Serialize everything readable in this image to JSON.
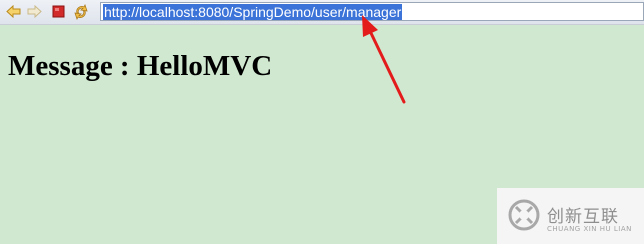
{
  "toolbar": {
    "buttons": [
      "back-icon",
      "forward-icon",
      "stop-icon",
      "refresh-icon"
    ],
    "address": {
      "url": "http://localhost:8080/SpringDemo/user/manager"
    }
  },
  "page": {
    "message": "Message : HelloMVC"
  },
  "watermark": {
    "brand_cn": "创新互联",
    "brand_en": "CHUANG XIN HU LIAN"
  },
  "colors": {
    "page_background": "#cfe8cf",
    "url_highlight": "#3b73d8",
    "annotation_arrow": "#e31b1b"
  }
}
